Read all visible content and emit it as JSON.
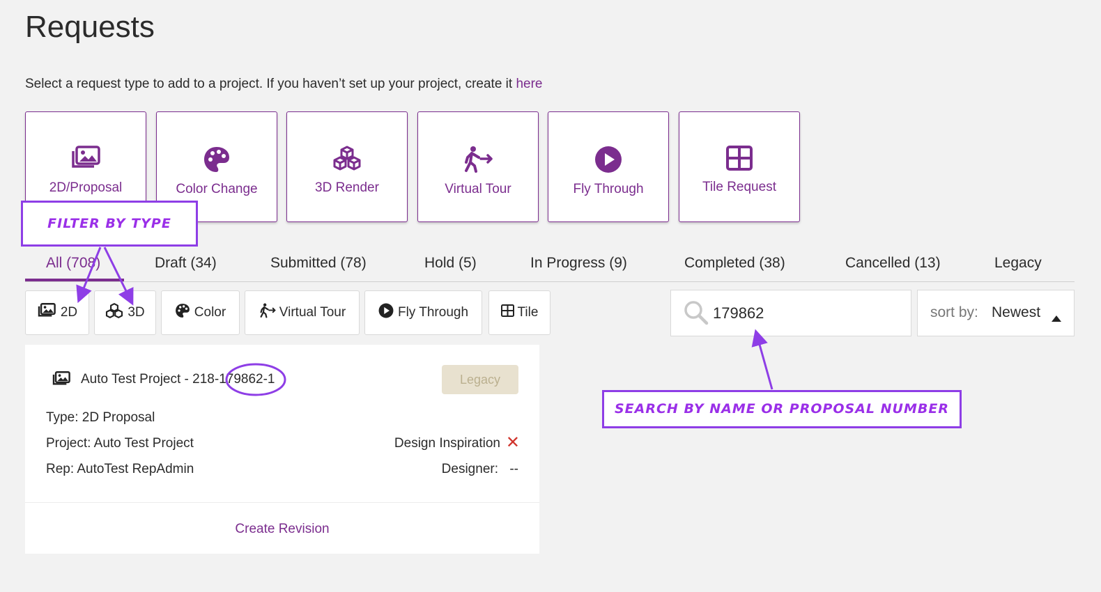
{
  "page": {
    "title": "Requests",
    "intro_text": "Select a request type to add to a project. If you haven’t set up your project, create it ",
    "intro_link": "here"
  },
  "request_types": [
    {
      "label": "2D/Proposal",
      "icon": "images-icon"
    },
    {
      "label": "Color Change",
      "icon": "palette-icon"
    },
    {
      "label": "3D Render",
      "icon": "cubes-icon"
    },
    {
      "label": "Virtual Tour",
      "icon": "walking-arrow-icon"
    },
    {
      "label": "Fly Through",
      "icon": "play-circle-icon"
    },
    {
      "label": "Tile Request",
      "icon": "grid-icon"
    }
  ],
  "status_tabs": [
    {
      "label": "All (708)",
      "active": true
    },
    {
      "label": "Draft (34)"
    },
    {
      "label": "Submitted (78)"
    },
    {
      "label": "Hold (5)"
    },
    {
      "label": "In Progress (9)"
    },
    {
      "label": "Completed (38)"
    },
    {
      "label": "Cancelled (13)"
    },
    {
      "label": "Legacy"
    }
  ],
  "type_filters": [
    {
      "label": "2D",
      "icon": "images-icon"
    },
    {
      "label": "3D",
      "icon": "cubes-icon"
    },
    {
      "label": "Color",
      "icon": "palette-icon"
    },
    {
      "label": "Virtual Tour",
      "icon": "walking-arrow-icon"
    },
    {
      "label": "Fly Through",
      "icon": "play-circle-icon"
    },
    {
      "label": "Tile",
      "icon": "grid-icon"
    }
  ],
  "search": {
    "value": "179862",
    "icon": "search-icon"
  },
  "sort": {
    "label": "sort by:",
    "value": "Newest",
    "icon": "caret-up-icon"
  },
  "request_card": {
    "title": "Auto Test Project - 218-179862-1",
    "badge": "Legacy",
    "type": "Type: 2D Proposal",
    "project": "Project: Auto Test Project",
    "rep": "Rep: AutoTest RepAdmin",
    "design_inspiration_label": "Design Inspiration",
    "design_inspiration_status": "✕",
    "designer_label": "Designer:",
    "designer_value": "--",
    "action": "Create Revision"
  },
  "annotations": {
    "filter_callout": "FILTER BY TYPE",
    "search_callout": "SEARCH BY NAME OR PROPOSAL NUMBER"
  },
  "colors": {
    "accent": "#7b2d8e",
    "callout": "#8e3ee6",
    "badge_bg": "#e8e1cf",
    "error": "#d0342c"
  }
}
